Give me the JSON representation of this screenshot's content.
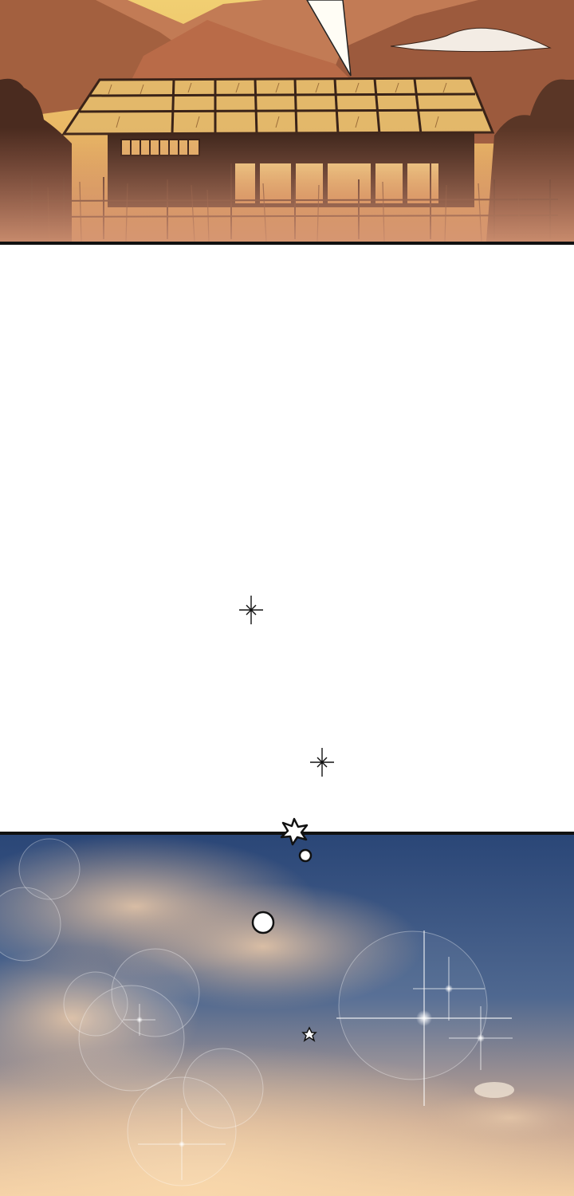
{
  "palette": {
    "sunset_sky": "#e7b25a",
    "mountain_far": "#b4724f",
    "mountain_near": "#7d4a34",
    "ground_haze": "#c9866a",
    "thatch": "#d9ad62",
    "house_dark": "#3a2318",
    "panel_border": "#111111",
    "night_blue": "#2d4c79",
    "cloud_warm": "#d9b79c",
    "horizon_glow": "#f1c9a1",
    "sparkle": "#ffffff"
  },
  "panels": [
    {
      "name": "farmhouse-at-sunset",
      "content": ""
    },
    {
      "name": "blank-gutter",
      "content": ""
    },
    {
      "name": "twilight-sky-with-bokeh",
      "content": ""
    }
  ]
}
